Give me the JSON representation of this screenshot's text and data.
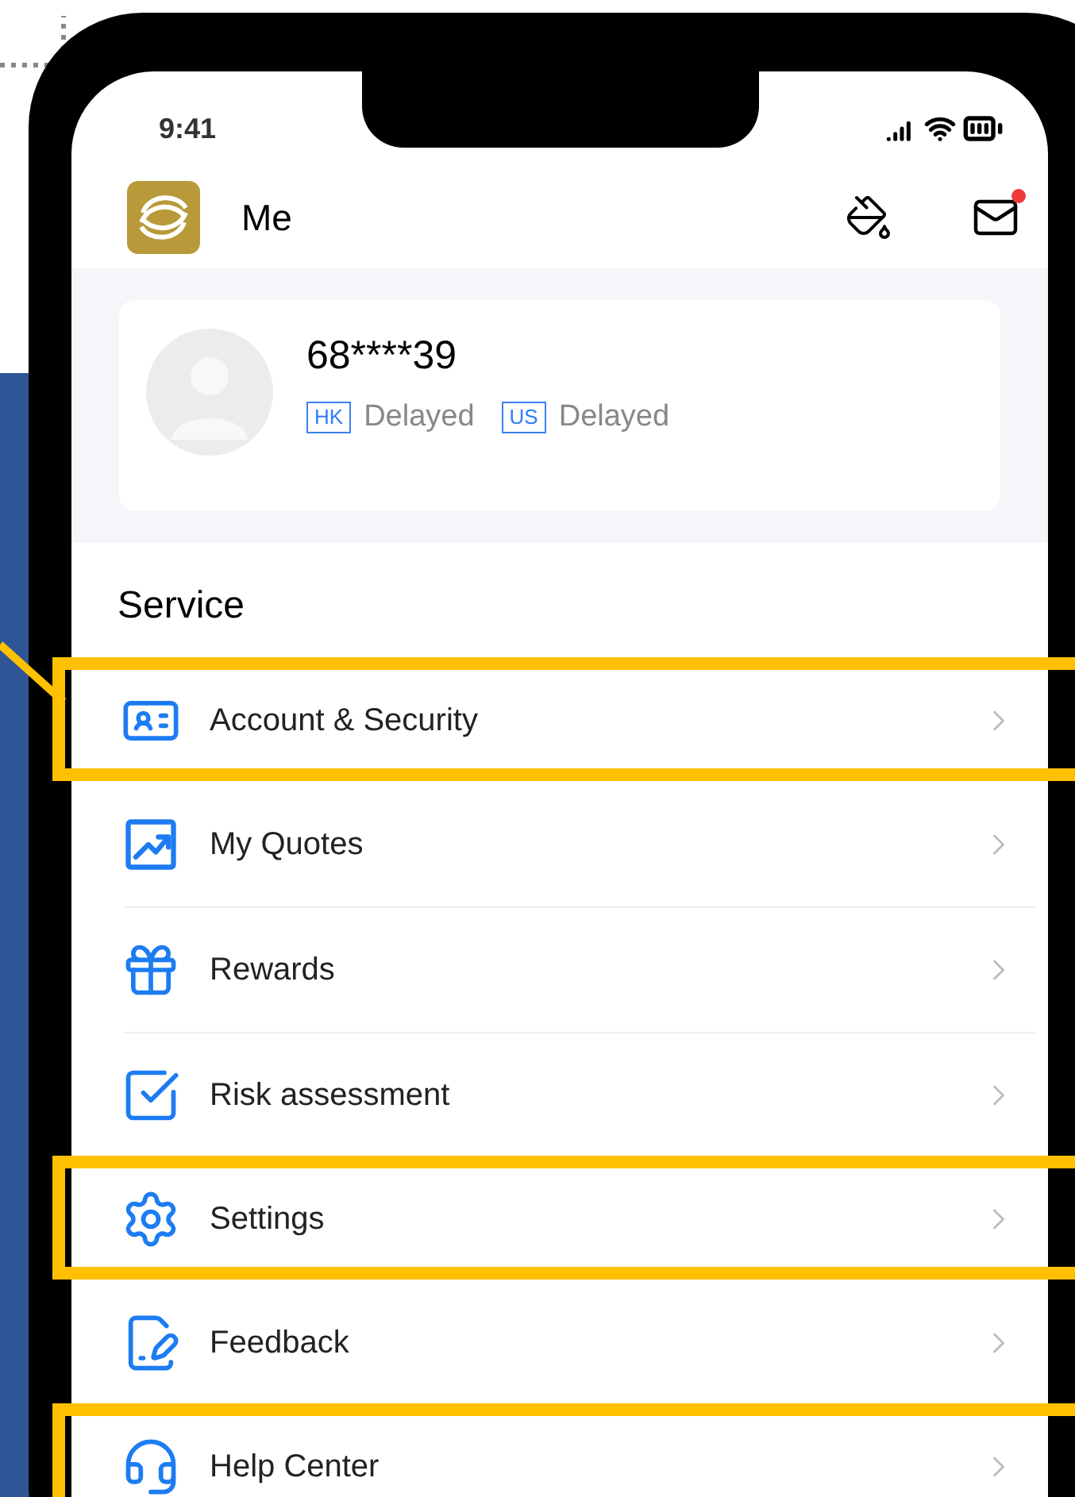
{
  "status_bar": {
    "time": "9:41"
  },
  "header": {
    "title": "Me",
    "unread": true
  },
  "profile": {
    "account": "68****39",
    "markets": [
      {
        "code": "HK",
        "status": "Delayed"
      },
      {
        "code": "US",
        "status": "Delayed"
      }
    ]
  },
  "service": {
    "title": "Service",
    "items": [
      {
        "label": "Account & Security",
        "highlighted": true
      },
      {
        "label": "My Quotes",
        "highlighted": false
      },
      {
        "label": "Rewards",
        "highlighted": false
      },
      {
        "label": "Risk assessment",
        "highlighted": false
      },
      {
        "label": "Settings",
        "highlighted": true
      },
      {
        "label": "Feedback",
        "highlighted": false
      },
      {
        "label": "Help Center",
        "highlighted": true
      }
    ]
  }
}
